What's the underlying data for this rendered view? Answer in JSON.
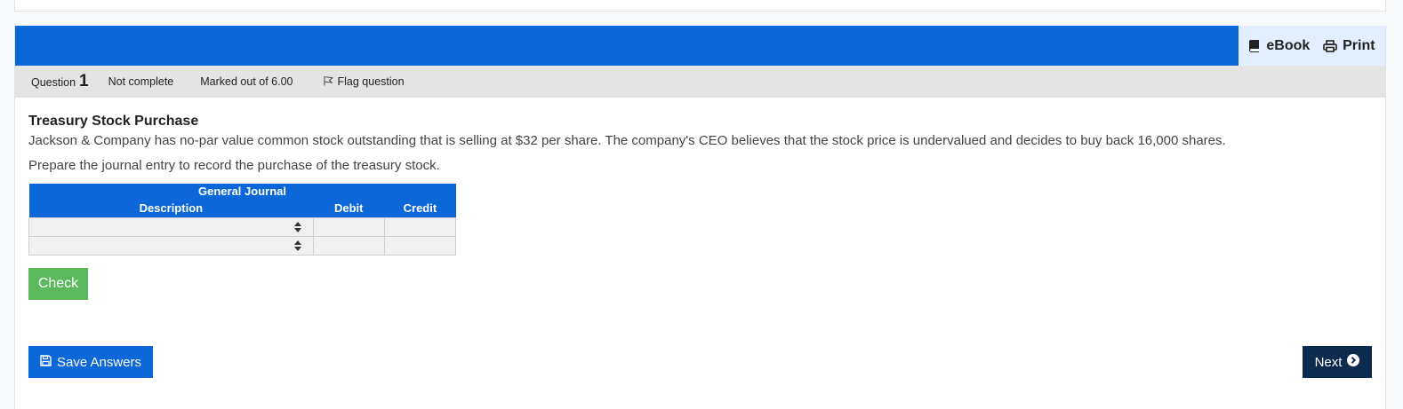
{
  "toolbar": {
    "ebook_label": "eBook",
    "print_label": "Print"
  },
  "question_info": {
    "question_label": "Question",
    "question_number": "1",
    "state": "Not complete",
    "marks": "Marked out of 6.00",
    "flag_label": "Flag question"
  },
  "question": {
    "title": "Treasury Stock Purchase",
    "text": "Jackson & Company has no-par value common stock outstanding that is selling at $32 per share. The company's CEO believes that the stock price is undervalued and decides to buy back 16,000 shares.",
    "prompt": "Prepare the journal entry to record the purchase of the treasury stock."
  },
  "journal": {
    "title": "General Journal",
    "columns": [
      "Description",
      "Debit",
      "Credit"
    ],
    "rows": [
      {
        "description": "",
        "debit": "",
        "credit": ""
      },
      {
        "description": "",
        "debit": "",
        "credit": ""
      }
    ]
  },
  "buttons": {
    "check": "Check",
    "save": "Save Answers",
    "next": "Next"
  },
  "colors": {
    "brand_blue": "#0c67d9",
    "check_green": "#5cb85c",
    "next_navy": "#0d2b4e",
    "info_bar": "#e4e4e4"
  },
  "icons": [
    "book-icon",
    "printer-icon",
    "flag-icon",
    "sort-arrows-icon",
    "save-icon",
    "circle-chevron-right-icon"
  ]
}
